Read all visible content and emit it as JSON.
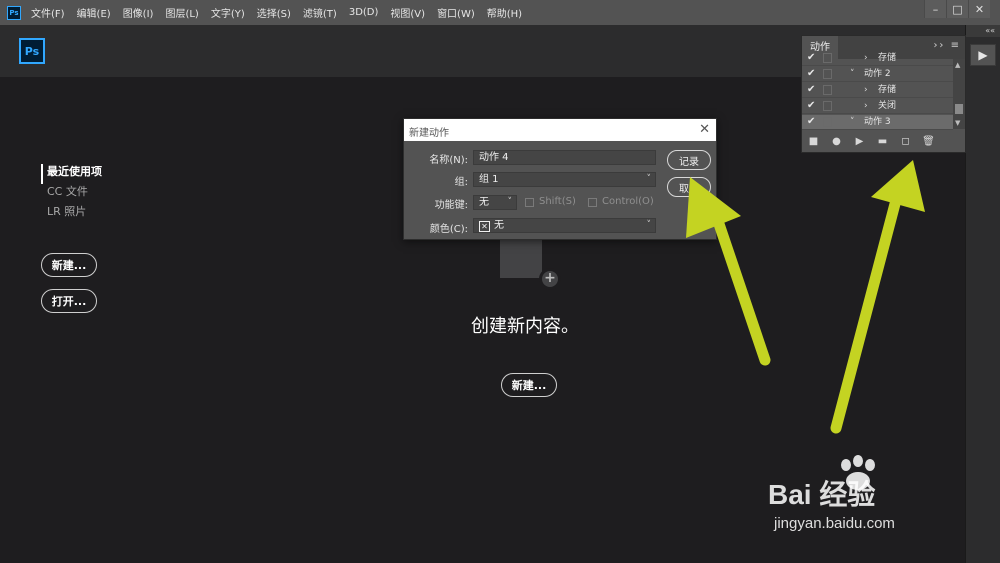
{
  "app": {
    "small_logo": "Ps",
    "logo": "Ps"
  },
  "menu": [
    "文件(F)",
    "编辑(E)",
    "图像(I)",
    "图层(L)",
    "文字(Y)",
    "选择(S)",
    "滤镜(T)",
    "3D(D)",
    "视图(V)",
    "窗口(W)",
    "帮助(H)"
  ],
  "window_controls": {
    "minimize": "–",
    "maximize": "□",
    "close": "✕"
  },
  "start": {
    "nav": [
      "最近使用项",
      "CC 文件",
      "LR 照片"
    ],
    "new_button": "新建...",
    "open_button": "打开...",
    "headline": "创建新内容。",
    "center_new_button": "新建..."
  },
  "actions_panel": {
    "tab": "动作",
    "header_icons": "›› ≡",
    "rows": [
      {
        "arrow": "›",
        "label": "存储"
      },
      {
        "arrow": "˅",
        "label": "动作 2"
      },
      {
        "arrow": "›",
        "label": "存储"
      },
      {
        "arrow": "›",
        "label": "关闭"
      },
      {
        "arrow": "˅",
        "label": "动作 3"
      }
    ],
    "footer": [
      "■",
      "●",
      "▶",
      "▬",
      "◻",
      "🗑"
    ]
  },
  "dialog": {
    "title": "新建动作",
    "close": "✕",
    "name_label": "名称(N):",
    "name_value": "动作 4",
    "group_label": "组:",
    "group_value": "组 1",
    "fkey_label": "功能键:",
    "fkey_value": "无",
    "shift_label": "Shift(S)",
    "control_label": "Control(O)",
    "color_label": "颜色(C):",
    "color_value": "无",
    "color_swatch": "✕",
    "record_button": "记录",
    "cancel_button": "取消"
  },
  "dock": {
    "collapse": "««",
    "play": "▶"
  },
  "watermark": {
    "brand": "Bai 经验",
    "url": "jingyan.baidu.com"
  },
  "colors": {
    "arrow": "#c4d322",
    "accent": "#31a8ff"
  }
}
